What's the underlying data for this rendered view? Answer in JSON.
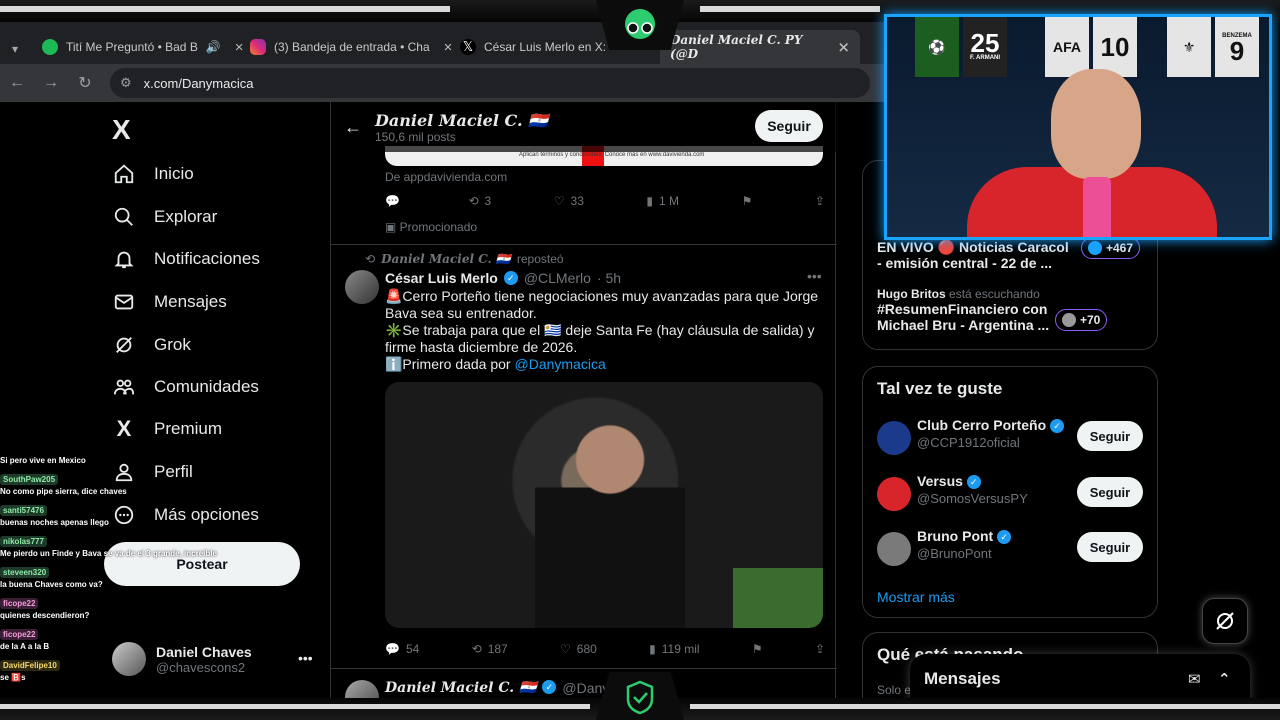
{
  "browser": {
    "tabs": [
      {
        "label": "Tití Me Preguntó • Bad B",
        "icon": "spotify-icon",
        "color": "#1db954"
      },
      {
        "label": "(3) Bandeja de entrada • Cha",
        "icon": "instagram-icon",
        "color": "#e1306c"
      },
      {
        "label": "César Luis Merlo en X: \"",
        "icon": "x-icon",
        "color": "#000000"
      },
      {
        "label": "Daniel Maciel C. PY (@D",
        "icon": "x-icon",
        "color": "#000000"
      }
    ],
    "url": "x.com/Danymacica"
  },
  "sidebar": {
    "logo": "X",
    "items": [
      {
        "label": "Inicio",
        "icon": "home-icon"
      },
      {
        "label": "Explorar",
        "icon": "search-icon"
      },
      {
        "label": "Notificaciones",
        "icon": "bell-icon"
      },
      {
        "label": "Mensajes",
        "icon": "mail-icon"
      },
      {
        "label": "Grok",
        "icon": "grok-icon"
      },
      {
        "label": "Comunidades",
        "icon": "people-icon"
      },
      {
        "label": "Premium",
        "icon": "x-premium-icon"
      },
      {
        "label": "Perfil",
        "icon": "person-icon"
      },
      {
        "label": "Más opciones",
        "icon": "more-circle-icon"
      }
    ],
    "post_label": "Postear",
    "account": {
      "name": "Daniel Chaves",
      "handle": "@chavescons2",
      "more": "•••"
    }
  },
  "feed": {
    "header": {
      "name": "Daniel Maciel C. 🇵🇾",
      "count": "150,6 mil posts",
      "follow": "Seguir"
    },
    "ad": {
      "image_text": "Aplican términos y condiciones. Conoce más en www.davivienda.com",
      "source": "De appdavivienda.com",
      "replies": "",
      "reposts": "3",
      "likes": "33",
      "views": "1 M",
      "promoted": "Promocionado"
    },
    "tweet": {
      "reposted_by": "Daniel Maciel C. 🇵🇾",
      "reposted_label": "reposteó",
      "name": "César Luis Merlo",
      "handle": "@CLMerlo",
      "time": "· 5h",
      "lines": [
        "🚨Cerro Porteño tiene negociaciones muy avanzadas para que Jorge Bava sea su entrenador.",
        "✳️Se trabaja para que el 🇺🇾 deje Santa Fe (hay cláusula de salida) y firme hasta diciembre de 2026.",
        "ℹ️Primero dada por "
      ],
      "mention": "@Danymacica",
      "replies": "54",
      "reposts": "187",
      "likes": "680",
      "views": "119 mil"
    },
    "next": {
      "name": "Daniel Maciel C. 🇵🇾",
      "handle": "@Dany"
    }
  },
  "right": {
    "trends": [
      {
        "title": "EN VIVO 🔴 Noticias Caracol - emisión central - 22 de ...",
        "pill": "+467"
      },
      {
        "user": "Hugo Britos",
        "meta": "está escuchando",
        "title": "#ResumenFinanciero con Michael Bru - Argentina ...",
        "pill": "+70"
      }
    ],
    "suggest_title": "Tal vez te guste",
    "suggestions": [
      {
        "name": "Club Cerro Porteño",
        "handle": "@CCP1912oficial",
        "btn": "Seguir",
        "color": "#1b3a8c"
      },
      {
        "name": "Versus",
        "handle": "@SomosVersusPY",
        "btn": "Seguir",
        "color": "#d8252b"
      },
      {
        "name": "Bruno Pont",
        "handle": "@BrunoPont",
        "btn": "Seguir",
        "color": "#7a7a7a"
      }
    ],
    "show_more": "Mostrar más",
    "happening": "Qué está pasando",
    "happening_meta": "Solo en",
    "dm_label": "Mensajes"
  },
  "chat": [
    {
      "user": "",
      "msg": "Si pero vive en Mexico"
    },
    {
      "user": "SouthPaw205",
      "msg": "No como pipe sierra, dice chaves"
    },
    {
      "user": "santi57476",
      "msg": "buenas noches apenas llego"
    },
    {
      "user": "nikolas777",
      "msg": "Me pierdo un Finde y Bava se va de el 3 grande, increible"
    },
    {
      "user": "steveen320",
      "msg": "la buena Chaves como va?"
    },
    {
      "user": "ficope22",
      "msg": "quienes descendieron?"
    },
    {
      "user": "ficope22",
      "msg": "de la A a la B"
    },
    {
      "user": "DavidFelipe10",
      "msg": "se 🅱️s"
    }
  ],
  "webcam": {
    "jerseys": [
      "25",
      "10"
    ],
    "jersey_caption": "F. ARMANI",
    "jersey_name": "BENZEMA"
  }
}
